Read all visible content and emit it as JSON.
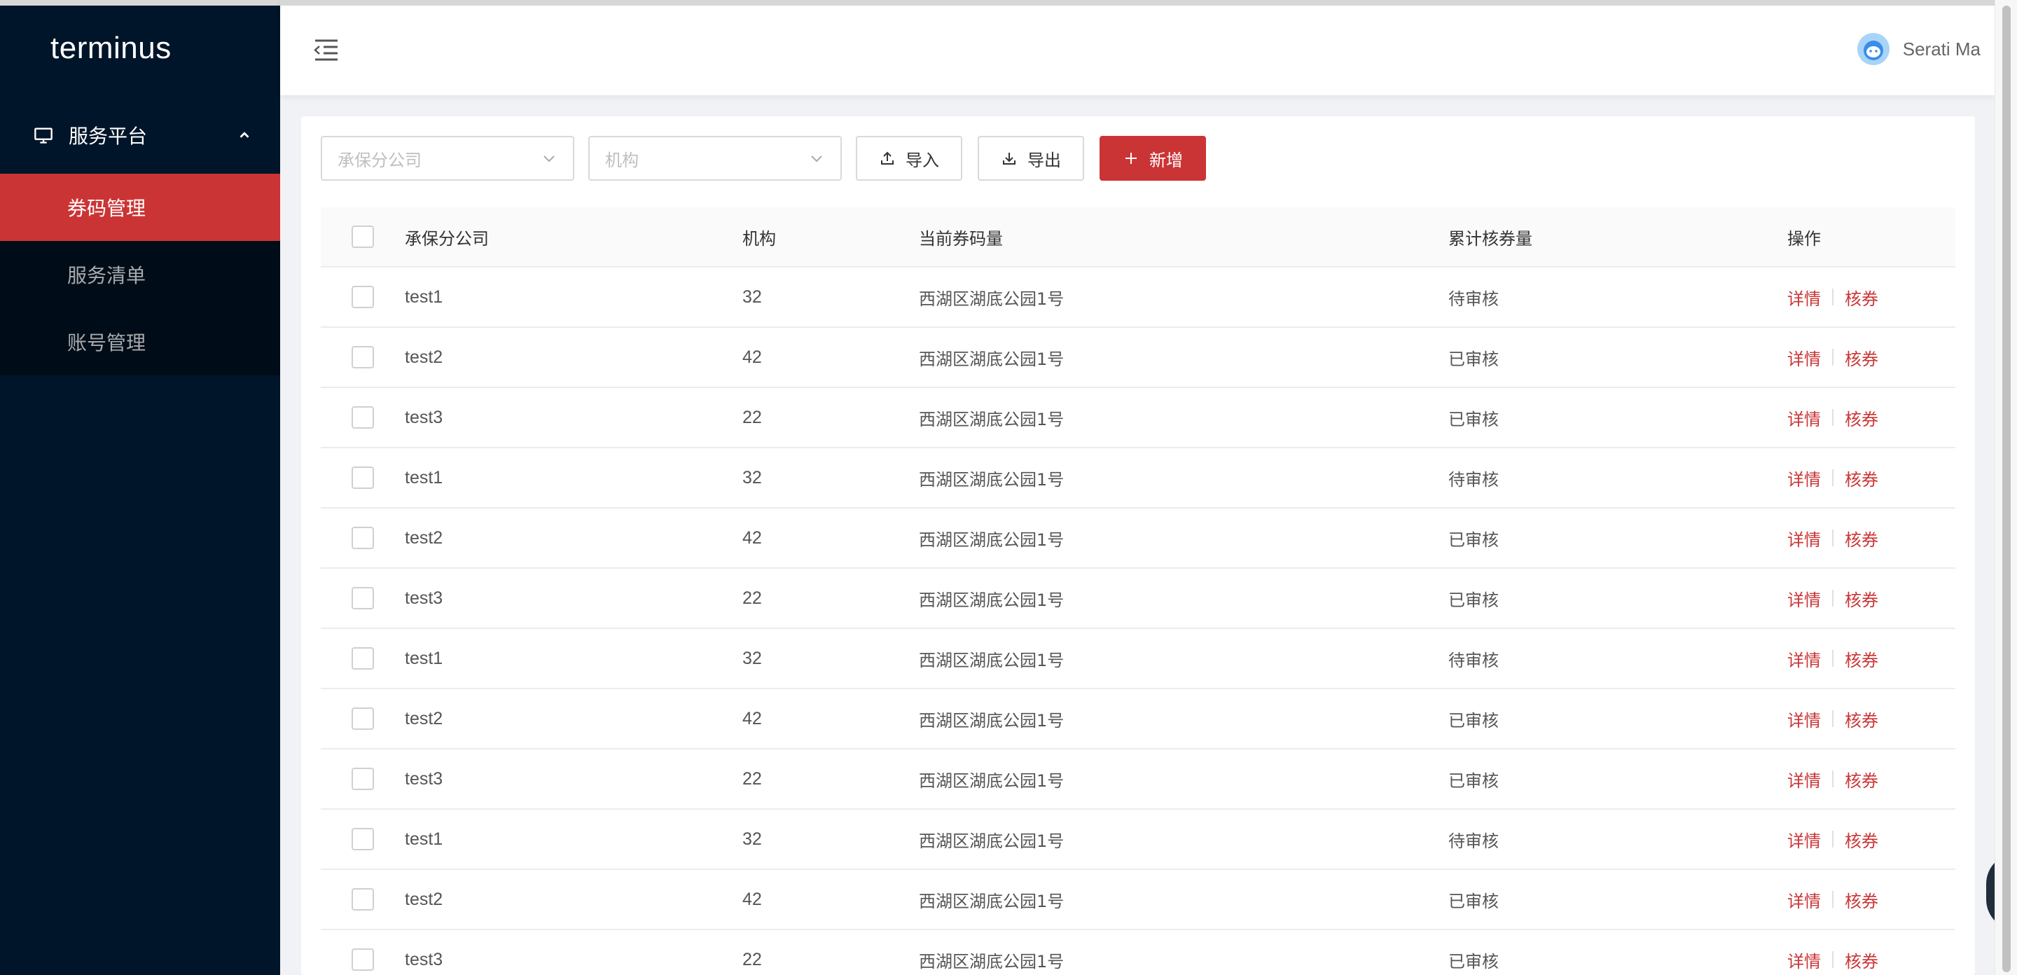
{
  "sidebar": {
    "logo": "terminus",
    "group": {
      "label": "服务平台",
      "icon": "monitor-icon",
      "expanded": true
    },
    "items": [
      {
        "label": "券码管理",
        "active": true
      },
      {
        "label": "服务清单",
        "active": false
      },
      {
        "label": "账号管理",
        "active": false
      }
    ]
  },
  "header": {
    "toggle_icon": "menu-fold-icon",
    "user_name": "Serati Ma"
  },
  "toolbar": {
    "company_placeholder": "承保分公司",
    "org_placeholder": "机构",
    "import_label": "导入",
    "export_label": "导出",
    "add_label": "新增"
  },
  "table": {
    "columns": [
      "承保分公司",
      "机构",
      "当前券码量",
      "累计核券量",
      "操作"
    ],
    "actions": {
      "detail": "详情",
      "verify": "核券"
    },
    "rows": [
      {
        "company": "test1",
        "org": "32",
        "amount": "西湖区湖底公园1号",
        "total": "待审核"
      },
      {
        "company": "test2",
        "org": "42",
        "amount": "西湖区湖底公园1号",
        "total": "已审核"
      },
      {
        "company": "test3",
        "org": "22",
        "amount": "西湖区湖底公园1号",
        "total": "已审核"
      },
      {
        "company": "test1",
        "org": "32",
        "amount": "西湖区湖底公园1号",
        "total": "待审核"
      },
      {
        "company": "test2",
        "org": "42",
        "amount": "西湖区湖底公园1号",
        "total": "已审核"
      },
      {
        "company": "test3",
        "org": "22",
        "amount": "西湖区湖底公园1号",
        "total": "已审核"
      },
      {
        "company": "test1",
        "org": "32",
        "amount": "西湖区湖底公园1号",
        "total": "待审核"
      },
      {
        "company": "test2",
        "org": "42",
        "amount": "西湖区湖底公园1号",
        "total": "已审核"
      },
      {
        "company": "test3",
        "org": "22",
        "amount": "西湖区湖底公园1号",
        "total": "已审核"
      },
      {
        "company": "test1",
        "org": "32",
        "amount": "西湖区湖底公园1号",
        "total": "待审核"
      },
      {
        "company": "test2",
        "org": "42",
        "amount": "西湖区湖底公园1号",
        "total": "已审核"
      },
      {
        "company": "test3",
        "org": "22",
        "amount": "西湖区湖底公园1号",
        "total": "已审核"
      }
    ]
  },
  "colors": {
    "sidebar_bg": "#001529",
    "submenu_bg": "#000c17",
    "accent": "#cb3435"
  }
}
